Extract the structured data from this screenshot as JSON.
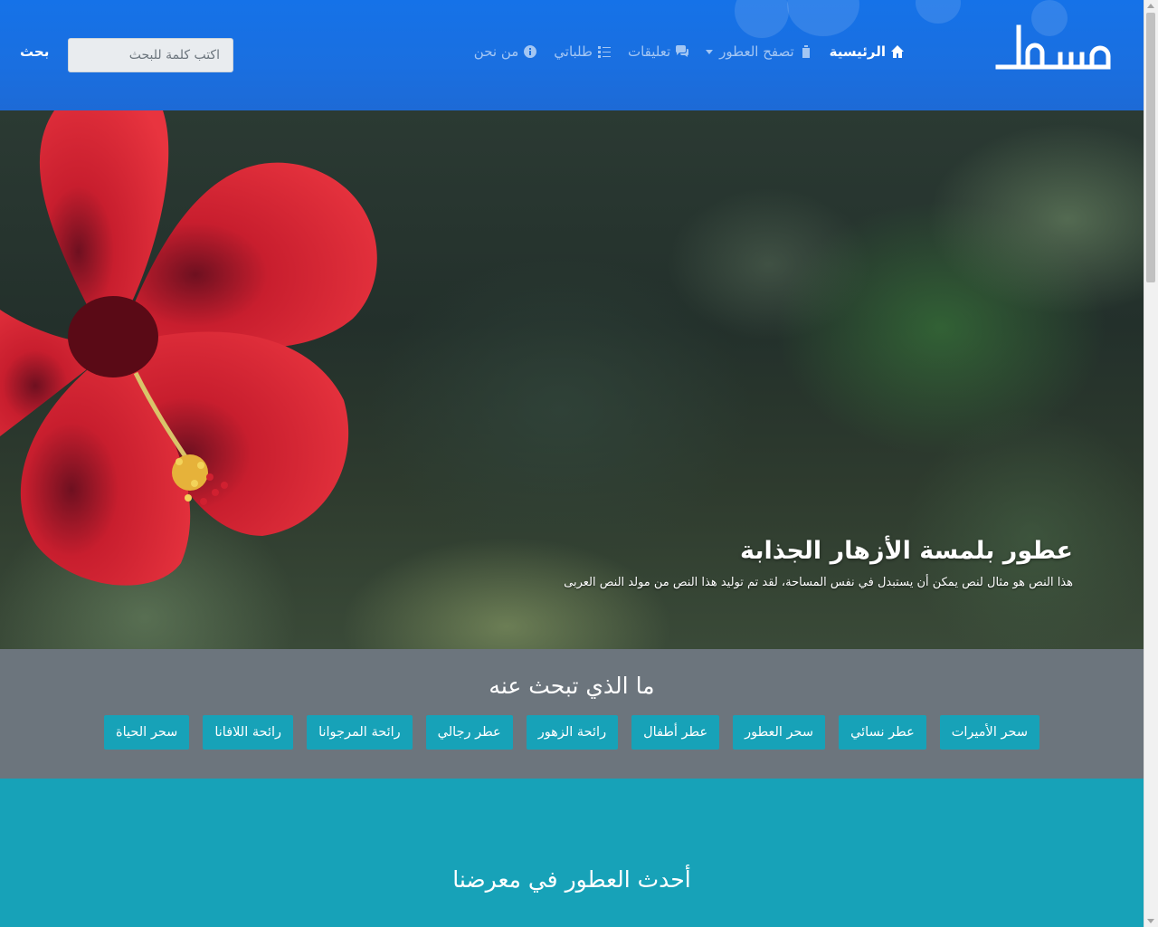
{
  "brand": {
    "logo_text": "مسط"
  },
  "nav": {
    "items": [
      {
        "label": "الرئيسية",
        "icon": "home-icon",
        "active": true
      },
      {
        "label": "تصفح العطور",
        "icon": "perfume-icon",
        "dropdown": true
      },
      {
        "label": "تعليقات",
        "icon": "comments-icon"
      },
      {
        "label": "طلباتي",
        "icon": "list-icon"
      },
      {
        "label": "من نحن",
        "icon": "info-icon"
      }
    ]
  },
  "search": {
    "placeholder": "اكتب كلمة للبحث",
    "button_label": "بحث"
  },
  "hero": {
    "title": "عطور بلمسة الأزهار الجذابة",
    "text": "هذا النص هو مثال لنص يمكن أن يستبدل في نفس المساحة، لقد تم توليد هذا النص من مولد النص العربى"
  },
  "categories": {
    "heading": "ما الذي تبحث عنه",
    "items": [
      "سحر الأميرات",
      "عطر نسائي",
      "سحر العطور",
      "عطر أطفال",
      "رائحة الزهور",
      "عطر رجالي",
      "رائحة المرجوانا",
      "رائحة اللافانا",
      "سحر الحياة"
    ]
  },
  "latest": {
    "heading": "أحدث العطور في معرضنا"
  },
  "colors": {
    "navbar": "#1572e8",
    "accent": "#17a2b8",
    "categories_bg": "#6c757d"
  }
}
